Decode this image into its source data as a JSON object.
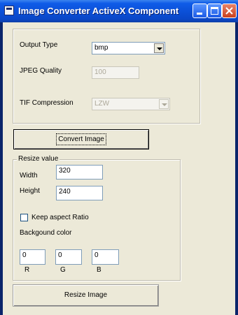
{
  "window": {
    "title": "Image Converter ActiveX Component"
  },
  "output": {
    "output_type_label": "Output Type",
    "output_type_value": "bmp",
    "jpeg_quality_label": "JPEG Quality",
    "jpeg_quality_value": "100",
    "tif_compression_label": "TIF Compression",
    "tif_compression_value": "LZW"
  },
  "convert_button": "Convert Image",
  "resize": {
    "group_title": "Resize value",
    "width_label": "Width",
    "width_value": "320",
    "height_label": "Height",
    "height_value": "240",
    "keep_aspect_label": "Keep aspect Ratio",
    "keep_aspect_checked": false,
    "background_label": "Backgound color",
    "r_value": "0",
    "g_value": "0",
    "b_value": "0",
    "r_label": "R",
    "g_label": "G",
    "b_label": "B"
  },
  "resize_button": "Resize Image"
}
